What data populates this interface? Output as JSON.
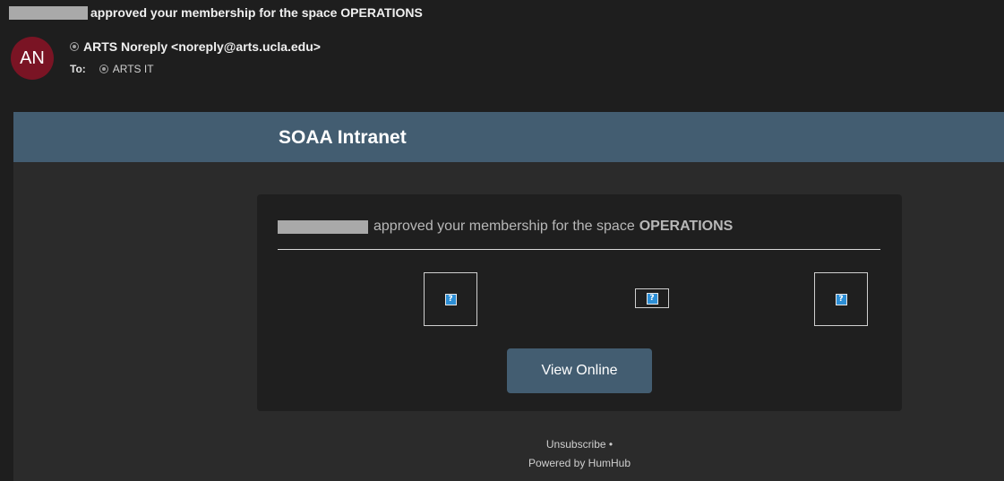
{
  "header": {
    "subject_text": "approved your membership for the space OPERATIONS",
    "avatar_initials": "AN",
    "sender": "ARTS Noreply <noreply@arts.ucla.edu>",
    "to_label": "To:",
    "recipient": "ARTS IT"
  },
  "email": {
    "brand_title": "SOAA Intranet",
    "message_text": "approved your membership for the space",
    "space_name": "OPERATIONS",
    "broken_image_glyph": "?",
    "view_button_label": "View Online",
    "footer": {
      "unsubscribe_label": "Unsubscribe",
      "separator": "•",
      "powered_by": "Powered by HumHub"
    }
  },
  "colors": {
    "background": "#1e1e1e",
    "brand_bar": "#435d71",
    "avatar": "#7a1424",
    "card": "#1f1f1f",
    "body_panel": "#2b2b2b"
  },
  "icons": {
    "contact": "contact-circle-icon",
    "broken_image": "broken-image-icon"
  }
}
